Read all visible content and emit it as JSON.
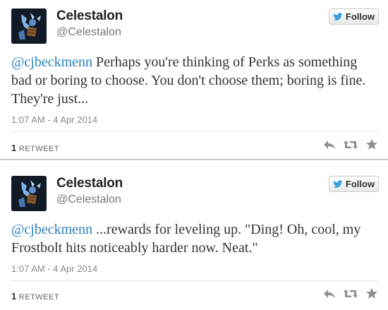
{
  "tweets": [
    {
      "author_name": "Celestalon",
      "author_handle": "@Celestalon",
      "follow_label": "Follow",
      "mention": "@cjbeckmenn",
      "text_body": " Perhaps you're thinking of Perks as something bad or boring to choose. You don't choose them; boring is fine. They're just...",
      "timestamp": "1:07 AM - 4 Apr 2014",
      "retweet_count": "1",
      "retweet_label": "RETWEET"
    },
    {
      "author_name": "Celestalon",
      "author_handle": "@Celestalon",
      "follow_label": "Follow",
      "mention": "@cjbeckmenn",
      "text_body": " ...rewards for leveling up. \"Ding! Oh, cool, my Frostbolt hits noticeably harder now. Neat.\"",
      "timestamp": "1:07 AM - 4 Apr 2014",
      "retweet_count": "1",
      "retweet_label": "RETWEET"
    }
  ],
  "icons": {
    "follow": "twitter-bird-icon",
    "reply": "reply-icon",
    "retweet": "retweet-icon",
    "favorite": "star-icon"
  },
  "colors": {
    "link": "#2a7fbf",
    "bird": "#3aa0e0",
    "action_icon": "#8f8f8f"
  }
}
